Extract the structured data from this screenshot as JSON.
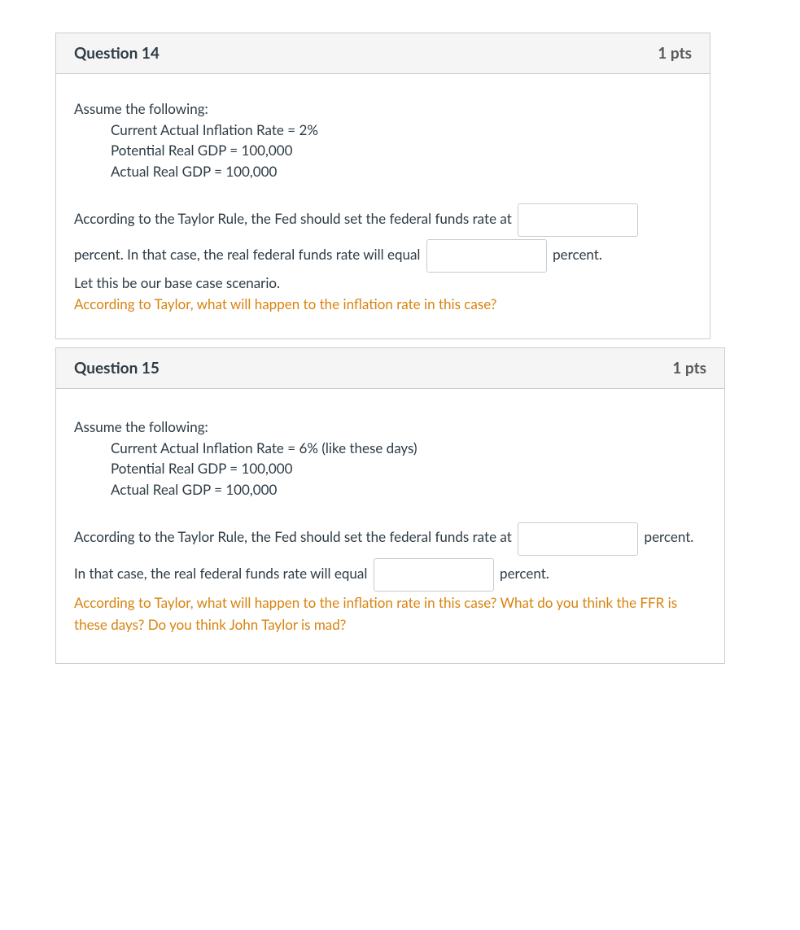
{
  "questions": [
    {
      "title": "Question 14",
      "points": "1 pts",
      "intro": "Assume the following:",
      "assumptions": [
        "Current Actual Inflation Rate = 2%",
        "Potential Real GDP = 100,000",
        "Actual Real GDP = 100,000"
      ],
      "fill_part1": "According to the Taylor Rule, the Fed should set the federal funds rate at ",
      "fill_part2": " percent. In that case, the real federal funds rate will equal ",
      "fill_part3": " percent.",
      "base_case": "Let this be our base case scenario.",
      "followup": "According to Taylor, what will happen to the inflation rate in this case?"
    },
    {
      "title": "Question 15",
      "points": "1 pts",
      "intro": "Assume the following:",
      "assumptions": [
        "Current Actual Inflation Rate = 6% (like these days)",
        "Potential Real GDP = 100,000",
        "Actual Real GDP = 100,000"
      ],
      "fill_part1": "According to the Taylor Rule, the Fed should set the federal funds rate at ",
      "fill_part2": " percent. In that case, the real federal funds rate will equal ",
      "fill_part3": " percent.",
      "followup": "According to Taylor, what will happen to the inflation rate in this case? What do you think the FFR is these days? Do you think John Taylor is mad?"
    }
  ]
}
